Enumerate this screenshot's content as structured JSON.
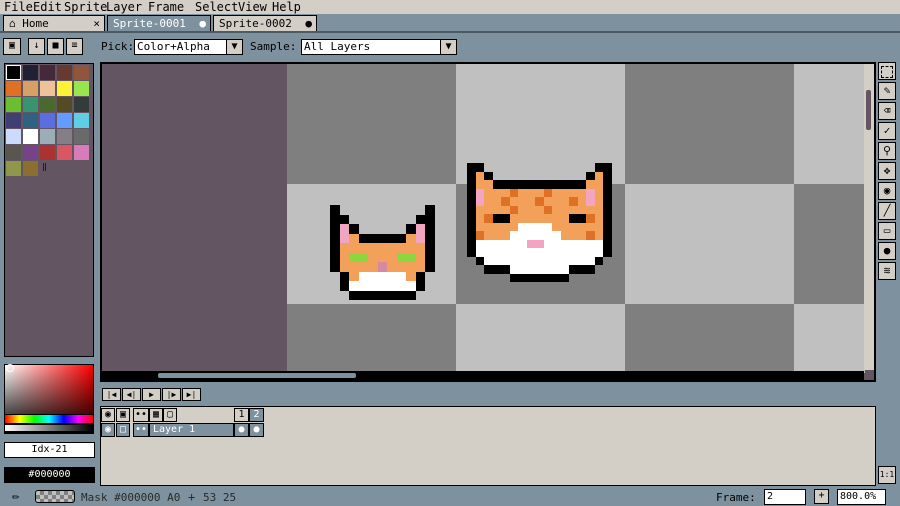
{
  "menu": [
    "File",
    "Edit",
    "Sprite",
    "Layer",
    "Frame",
    "Select",
    "View",
    "Help"
  ],
  "tabs": [
    {
      "label": "Home",
      "close": "×"
    },
    {
      "label": "Sprite-0001",
      "close": "●"
    },
    {
      "label": "Sprite-0002",
      "close": "●"
    }
  ],
  "toolbar": {
    "pick_label": "Pick:",
    "pick_value": "Color+Alpha",
    "sample_label": "Sample:",
    "sample_value": "All Layers"
  },
  "palette": {
    "colors": [
      "#000000",
      "#222034",
      "#45283c",
      "#663931",
      "#8f563b",
      "#df7126",
      "#d9a066",
      "#eec39a",
      "#fbf236",
      "#99e550",
      "#6abe30",
      "#37946e",
      "#4b692f",
      "#524b24",
      "#323c39",
      "#3f3f74",
      "#306082",
      "#5b6ee1",
      "#639bff",
      "#5fcde4",
      "#cbdbfc",
      "#ffffff",
      "#9badb7",
      "#847e87",
      "#696a6a",
      "#595652",
      "#76428a",
      "#ac3232",
      "#d95763",
      "#d77bba",
      "#8f974a",
      "#8a6f30"
    ]
  },
  "color_index": "Idx-21",
  "hex_value": "#000000",
  "timeline": {
    "layer_name": "Layer 1",
    "frames": [
      "1",
      "2"
    ]
  },
  "status": {
    "mask_text": "Mask #000000 A0",
    "coords": "53 25",
    "frame_label": "Frame:",
    "frame_value": "2",
    "zoom": "800.0%"
  },
  "colors": {
    "accent": "#7d929e",
    "panel": "#d4cfc6",
    "canvas_bg": "#635561",
    "check_dark": "#7f7f7f",
    "check_light": "#c0c0c0"
  }
}
